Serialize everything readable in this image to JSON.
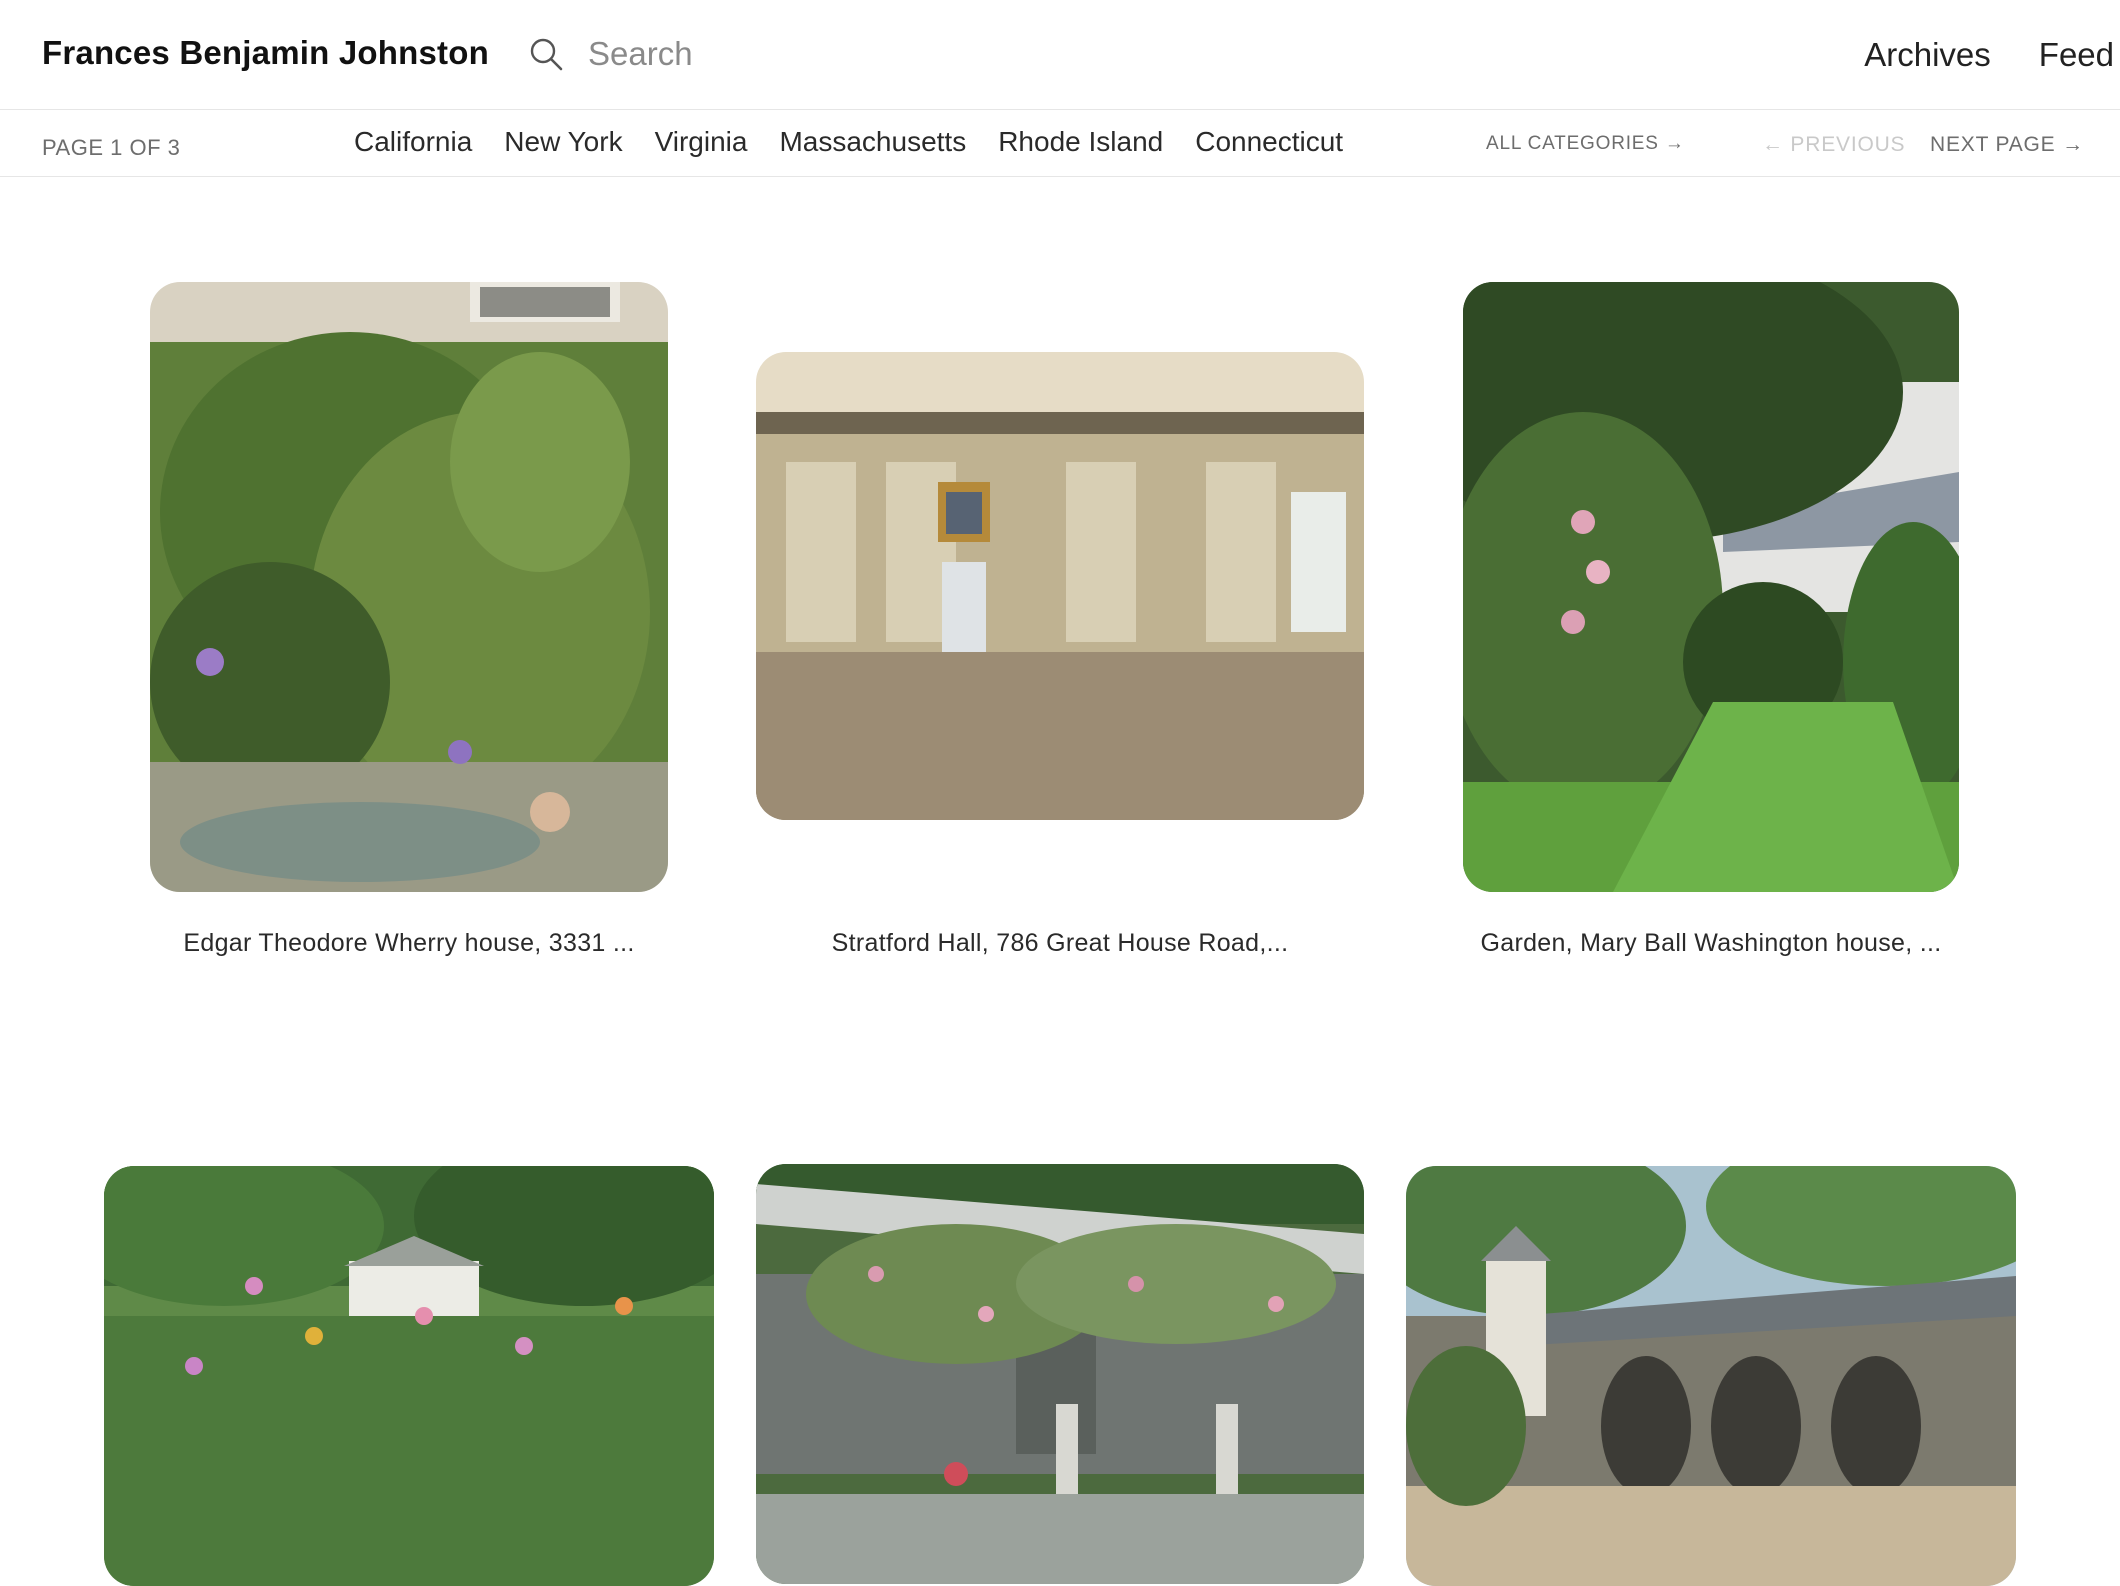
{
  "header": {
    "site_title": "Frances Benjamin Johnston",
    "search_placeholder": "Search",
    "links": [
      "Archives",
      "Feed"
    ]
  },
  "subnav": {
    "page_indicator": "PAGE 1 OF 3",
    "categories": [
      "California",
      "New York",
      "Virginia",
      "Massachusetts",
      "Rhode Island",
      "Connecticut"
    ],
    "all_categories": "ALL CATEGORIES →",
    "previous": "← PREVIOUS",
    "next": "NEXT PAGE →"
  },
  "gallery": {
    "items": [
      {
        "caption": "Edgar Theodore Wherry house, 3331 ..."
      },
      {
        "caption": "Stratford Hall, 786 Great House Road,..."
      },
      {
        "caption": "Garden, Mary Ball Washington house, ..."
      },
      {
        "caption": ""
      },
      {
        "caption": ""
      },
      {
        "caption": ""
      }
    ]
  }
}
